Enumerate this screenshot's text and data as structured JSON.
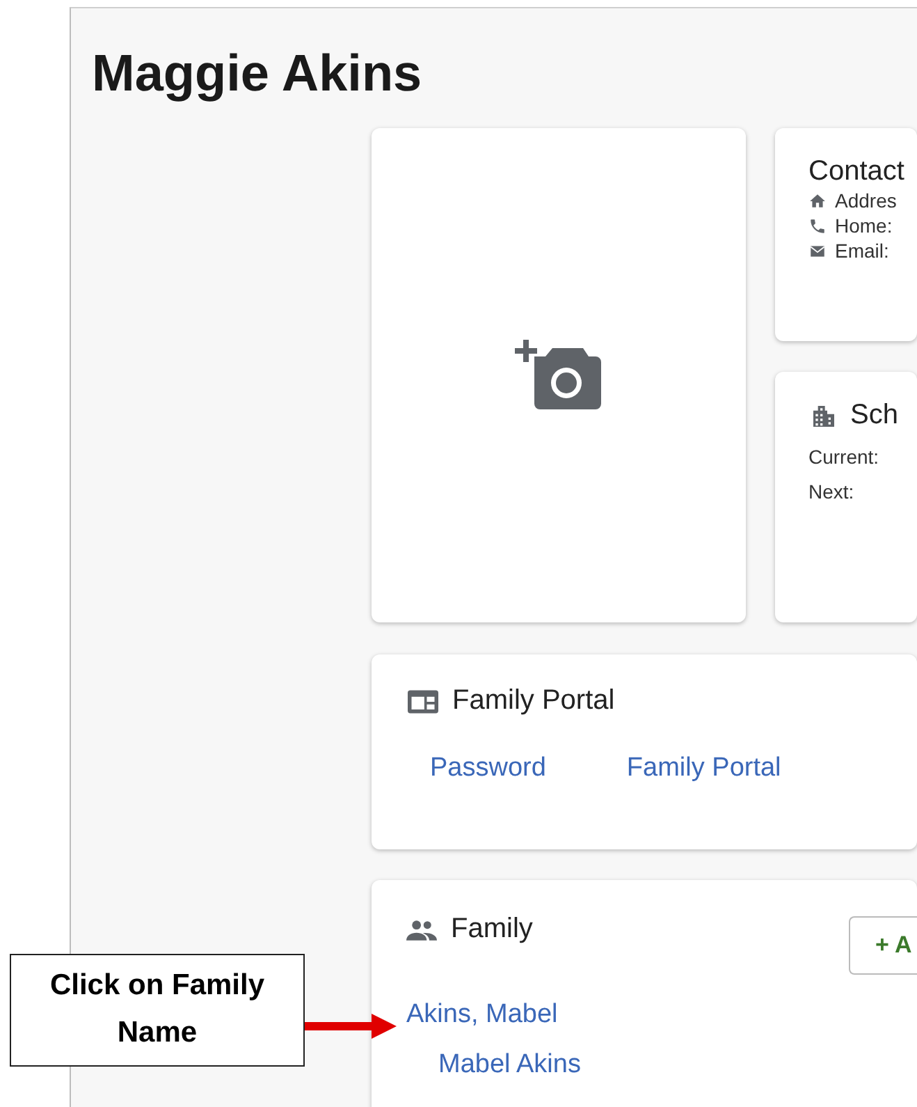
{
  "page_title": "Maggie Akins",
  "contact": {
    "title": "Contact",
    "rows": [
      {
        "kind": "address",
        "label": "Addres"
      },
      {
        "kind": "phone",
        "label": "Home:"
      },
      {
        "kind": "email",
        "label": "Email:"
      }
    ]
  },
  "school": {
    "title": "Sch",
    "rows": [
      "Current:",
      "Next:"
    ]
  },
  "family_portal": {
    "title": "Family Portal",
    "links": [
      "Password",
      "Family Portal"
    ]
  },
  "family": {
    "title": "Family",
    "add_button": "+ A",
    "members": [
      {
        "name": "Akins, Mabel",
        "display_name": "Mabel Akins"
      }
    ]
  },
  "callout": {
    "text": "Click on Family Name"
  }
}
